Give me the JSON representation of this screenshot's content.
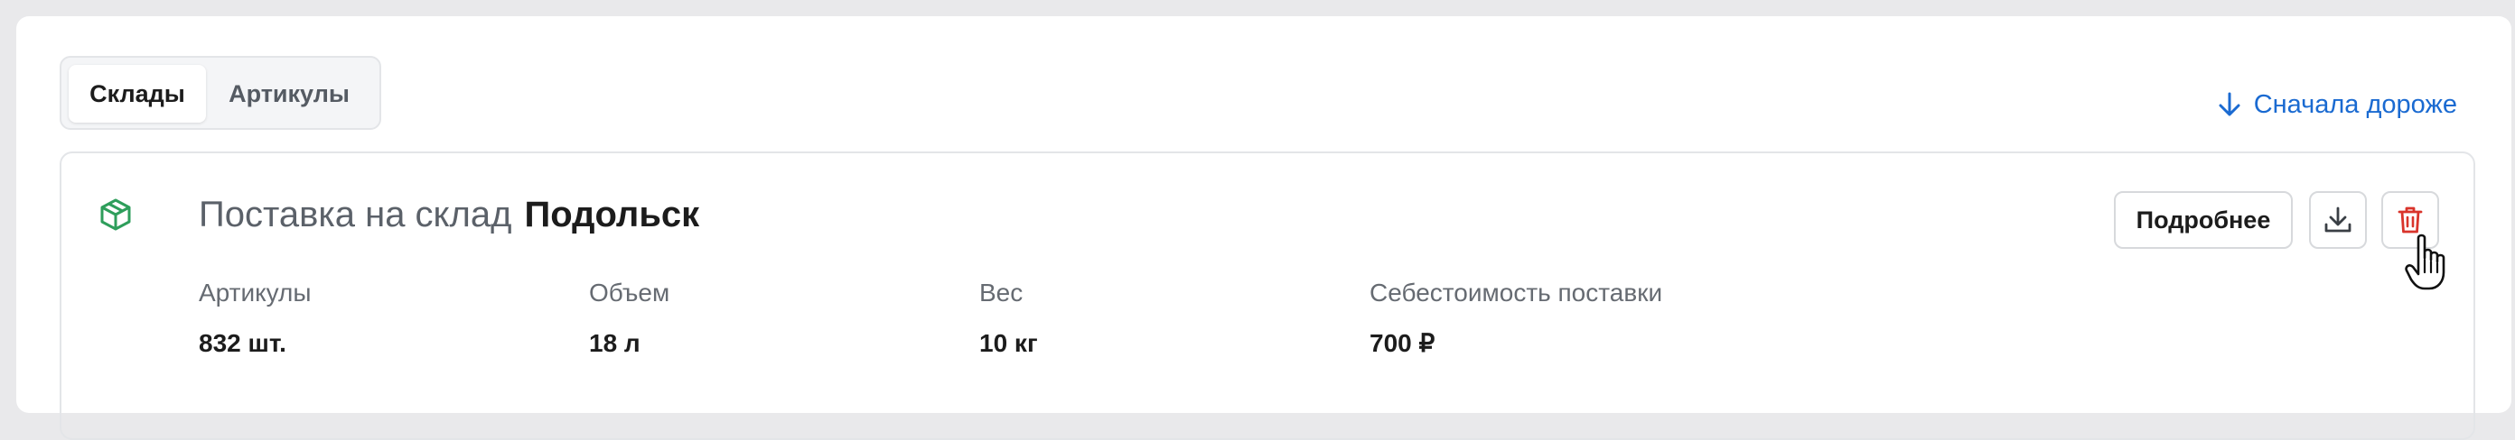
{
  "tabs": [
    {
      "label": "Склады",
      "active": true
    },
    {
      "label": "Артикулы",
      "active": false
    }
  ],
  "sort": {
    "label": "Сначала дороже",
    "icon": "arrow-down-icon"
  },
  "card": {
    "icon": "package-icon",
    "title_prefix": "Поставка на склад",
    "title_city": "Подольск",
    "stats": [
      {
        "label": "Артикулы",
        "value": "832 шт."
      },
      {
        "label": "Объем",
        "value": "18 л"
      },
      {
        "label": "Вес",
        "value": "10 кг"
      },
      {
        "label": "Себестоимость поставки",
        "value": "700 ₽"
      }
    ],
    "details_label": "Подробнее",
    "download_icon": "download-icon",
    "delete_icon": "trash-icon"
  },
  "colors": {
    "accent": "#1a6ad1",
    "success": "#2e9e5b",
    "danger": "#d9342b"
  }
}
